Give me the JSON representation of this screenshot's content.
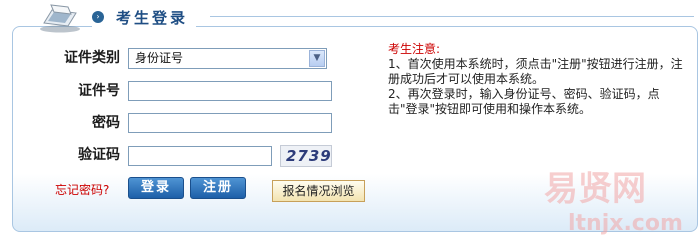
{
  "header": {
    "title": "考生登录"
  },
  "form": {
    "id_type_label": "证件类别",
    "id_type_value": "身份证号",
    "id_number_label": "证件号",
    "password_label": "密码",
    "captcha_label": "验证码",
    "captcha_text": "2739"
  },
  "actions": {
    "forgot_label": "忘记密码?",
    "login_label": "登录",
    "register_label": "注册",
    "browse_label": "报名情况浏览"
  },
  "notice": {
    "title": "考生注意:",
    "line1": "1、首次使用本系统时，须点击\"注册\"按钮进行注册，注册成功后才可以使用本系统。",
    "line2": "2、再次登录时，输入身份证号、密码、验证码，点击\"登录\"按钮即可使用和操作本系统。"
  },
  "watermark": {
    "brand": "易贤网",
    "url": "ltnjx.com"
  },
  "colors": {
    "accent": "#1f4e84",
    "button": "#2a6fb8",
    "warning": "#cc0000",
    "border": "#a9c6e2"
  }
}
